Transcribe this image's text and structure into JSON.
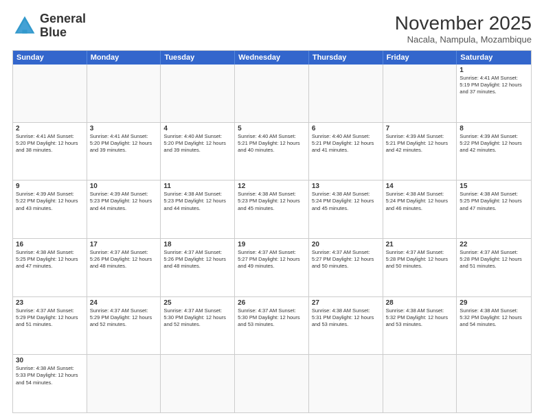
{
  "logo": {
    "line1": "General",
    "line2": "Blue"
  },
  "title": "November 2025",
  "subtitle": "Nacala, Nampula, Mozambique",
  "days_of_week": [
    "Sunday",
    "Monday",
    "Tuesday",
    "Wednesday",
    "Thursday",
    "Friday",
    "Saturday"
  ],
  "weeks": [
    [
      {
        "day": "",
        "empty": true
      },
      {
        "day": "",
        "empty": true
      },
      {
        "day": "",
        "empty": true
      },
      {
        "day": "",
        "empty": true
      },
      {
        "day": "",
        "empty": true
      },
      {
        "day": "",
        "empty": true
      },
      {
        "day": "1",
        "info": "Sunrise: 4:41 AM\nSunset: 5:19 PM\nDaylight: 12 hours\nand 37 minutes."
      }
    ],
    [
      {
        "day": "2",
        "info": "Sunrise: 4:41 AM\nSunset: 5:20 PM\nDaylight: 12 hours\nand 38 minutes."
      },
      {
        "day": "3",
        "info": "Sunrise: 4:41 AM\nSunset: 5:20 PM\nDaylight: 12 hours\nand 39 minutes."
      },
      {
        "day": "4",
        "info": "Sunrise: 4:40 AM\nSunset: 5:20 PM\nDaylight: 12 hours\nand 39 minutes."
      },
      {
        "day": "5",
        "info": "Sunrise: 4:40 AM\nSunset: 5:21 PM\nDaylight: 12 hours\nand 40 minutes."
      },
      {
        "day": "6",
        "info": "Sunrise: 4:40 AM\nSunset: 5:21 PM\nDaylight: 12 hours\nand 41 minutes."
      },
      {
        "day": "7",
        "info": "Sunrise: 4:39 AM\nSunset: 5:21 PM\nDaylight: 12 hours\nand 42 minutes."
      },
      {
        "day": "8",
        "info": "Sunrise: 4:39 AM\nSunset: 5:22 PM\nDaylight: 12 hours\nand 42 minutes."
      }
    ],
    [
      {
        "day": "9",
        "info": "Sunrise: 4:39 AM\nSunset: 5:22 PM\nDaylight: 12 hours\nand 43 minutes."
      },
      {
        "day": "10",
        "info": "Sunrise: 4:39 AM\nSunset: 5:23 PM\nDaylight: 12 hours\nand 44 minutes."
      },
      {
        "day": "11",
        "info": "Sunrise: 4:38 AM\nSunset: 5:23 PM\nDaylight: 12 hours\nand 44 minutes."
      },
      {
        "day": "12",
        "info": "Sunrise: 4:38 AM\nSunset: 5:23 PM\nDaylight: 12 hours\nand 45 minutes."
      },
      {
        "day": "13",
        "info": "Sunrise: 4:38 AM\nSunset: 5:24 PM\nDaylight: 12 hours\nand 45 minutes."
      },
      {
        "day": "14",
        "info": "Sunrise: 4:38 AM\nSunset: 5:24 PM\nDaylight: 12 hours\nand 46 minutes."
      },
      {
        "day": "15",
        "info": "Sunrise: 4:38 AM\nSunset: 5:25 PM\nDaylight: 12 hours\nand 47 minutes."
      }
    ],
    [
      {
        "day": "16",
        "info": "Sunrise: 4:38 AM\nSunset: 5:25 PM\nDaylight: 12 hours\nand 47 minutes."
      },
      {
        "day": "17",
        "info": "Sunrise: 4:37 AM\nSunset: 5:26 PM\nDaylight: 12 hours\nand 48 minutes."
      },
      {
        "day": "18",
        "info": "Sunrise: 4:37 AM\nSunset: 5:26 PM\nDaylight: 12 hours\nand 48 minutes."
      },
      {
        "day": "19",
        "info": "Sunrise: 4:37 AM\nSunset: 5:27 PM\nDaylight: 12 hours\nand 49 minutes."
      },
      {
        "day": "20",
        "info": "Sunrise: 4:37 AM\nSunset: 5:27 PM\nDaylight: 12 hours\nand 50 minutes."
      },
      {
        "day": "21",
        "info": "Sunrise: 4:37 AM\nSunset: 5:28 PM\nDaylight: 12 hours\nand 50 minutes."
      },
      {
        "day": "22",
        "info": "Sunrise: 4:37 AM\nSunset: 5:28 PM\nDaylight: 12 hours\nand 51 minutes."
      }
    ],
    [
      {
        "day": "23",
        "info": "Sunrise: 4:37 AM\nSunset: 5:29 PM\nDaylight: 12 hours\nand 51 minutes."
      },
      {
        "day": "24",
        "info": "Sunrise: 4:37 AM\nSunset: 5:29 PM\nDaylight: 12 hours\nand 52 minutes."
      },
      {
        "day": "25",
        "info": "Sunrise: 4:37 AM\nSunset: 5:30 PM\nDaylight: 12 hours\nand 52 minutes."
      },
      {
        "day": "26",
        "info": "Sunrise: 4:37 AM\nSunset: 5:30 PM\nDaylight: 12 hours\nand 53 minutes."
      },
      {
        "day": "27",
        "info": "Sunrise: 4:38 AM\nSunset: 5:31 PM\nDaylight: 12 hours\nand 53 minutes."
      },
      {
        "day": "28",
        "info": "Sunrise: 4:38 AM\nSunset: 5:32 PM\nDaylight: 12 hours\nand 53 minutes."
      },
      {
        "day": "29",
        "info": "Sunrise: 4:38 AM\nSunset: 5:32 PM\nDaylight: 12 hours\nand 54 minutes."
      }
    ],
    [
      {
        "day": "30",
        "info": "Sunrise: 4:38 AM\nSunset: 5:33 PM\nDaylight: 12 hours\nand 54 minutes."
      },
      {
        "day": "",
        "empty": true
      },
      {
        "day": "",
        "empty": true
      },
      {
        "day": "",
        "empty": true
      },
      {
        "day": "",
        "empty": true
      },
      {
        "day": "",
        "empty": true
      },
      {
        "day": "",
        "empty": true
      }
    ]
  ]
}
